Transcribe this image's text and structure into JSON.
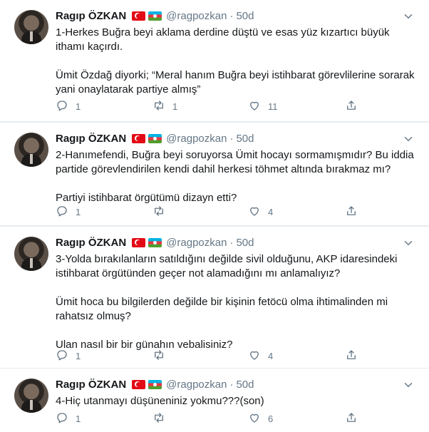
{
  "author": {
    "name": "Ragıp ÖZKAN",
    "handle": "@ragpozkan",
    "separator": "·",
    "flags": [
      "turkey-flag",
      "azerbaijan-flag"
    ]
  },
  "icons": {
    "reply": "reply-icon",
    "retweet": "retweet-icon",
    "like": "like-icon",
    "share": "share-icon",
    "more": "chevron-down-icon"
  },
  "colors": {
    "text": "#14171a",
    "muted": "#657786",
    "divider": "#e6ecf0"
  },
  "tweets": [
    {
      "time": "50d",
      "paragraphs": [
        "1-Herkes Buğra beyi aklama derdine düştü ve esas yüz kızartıcı büyük ithamı kaçırdı.",
        "Ümit Özdağ diyorki; “Meral hanım Buğra beyi istihbarat görevlilerine sorarak yani onaylatarak partiye almış”"
      ],
      "replies": "1",
      "retweets": "1",
      "likes": "11"
    },
    {
      "time": "50d",
      "paragraphs": [
        "2-Hanımefendi, Buğra beyi soruyorsa Ümit hocayı sormamışmıdır? Bu iddia partide görevlendirilen kendi dahil herkesi töhmet altında bırakmaz mı?",
        "Partiyi istihbarat örgütümü dizayn etti?"
      ],
      "replies": "1",
      "retweets": "",
      "likes": "4"
    },
    {
      "time": "50d",
      "paragraphs": [
        "3-Yolda bırakılanların satıldığını değilde sivil olduğunu, AKP idaresindeki istihbarat örgütünden geçer not alamadığını mı anlamalıyız?",
        "Ümit hoca bu bilgilerden değilde bir kişinin fetöcü olma ihtimalinden mi rahatsız olmuş?",
        "Ulan nasıl bir bir günahın vebalisiniz?"
      ],
      "replies": "1",
      "retweets": "",
      "likes": "4"
    },
    {
      "time": "50d",
      "paragraphs": [
        "4-Hiç utanmayı düşüneniniz yokmu???(son)"
      ],
      "replies": "1",
      "retweets": "",
      "likes": "6"
    }
  ]
}
